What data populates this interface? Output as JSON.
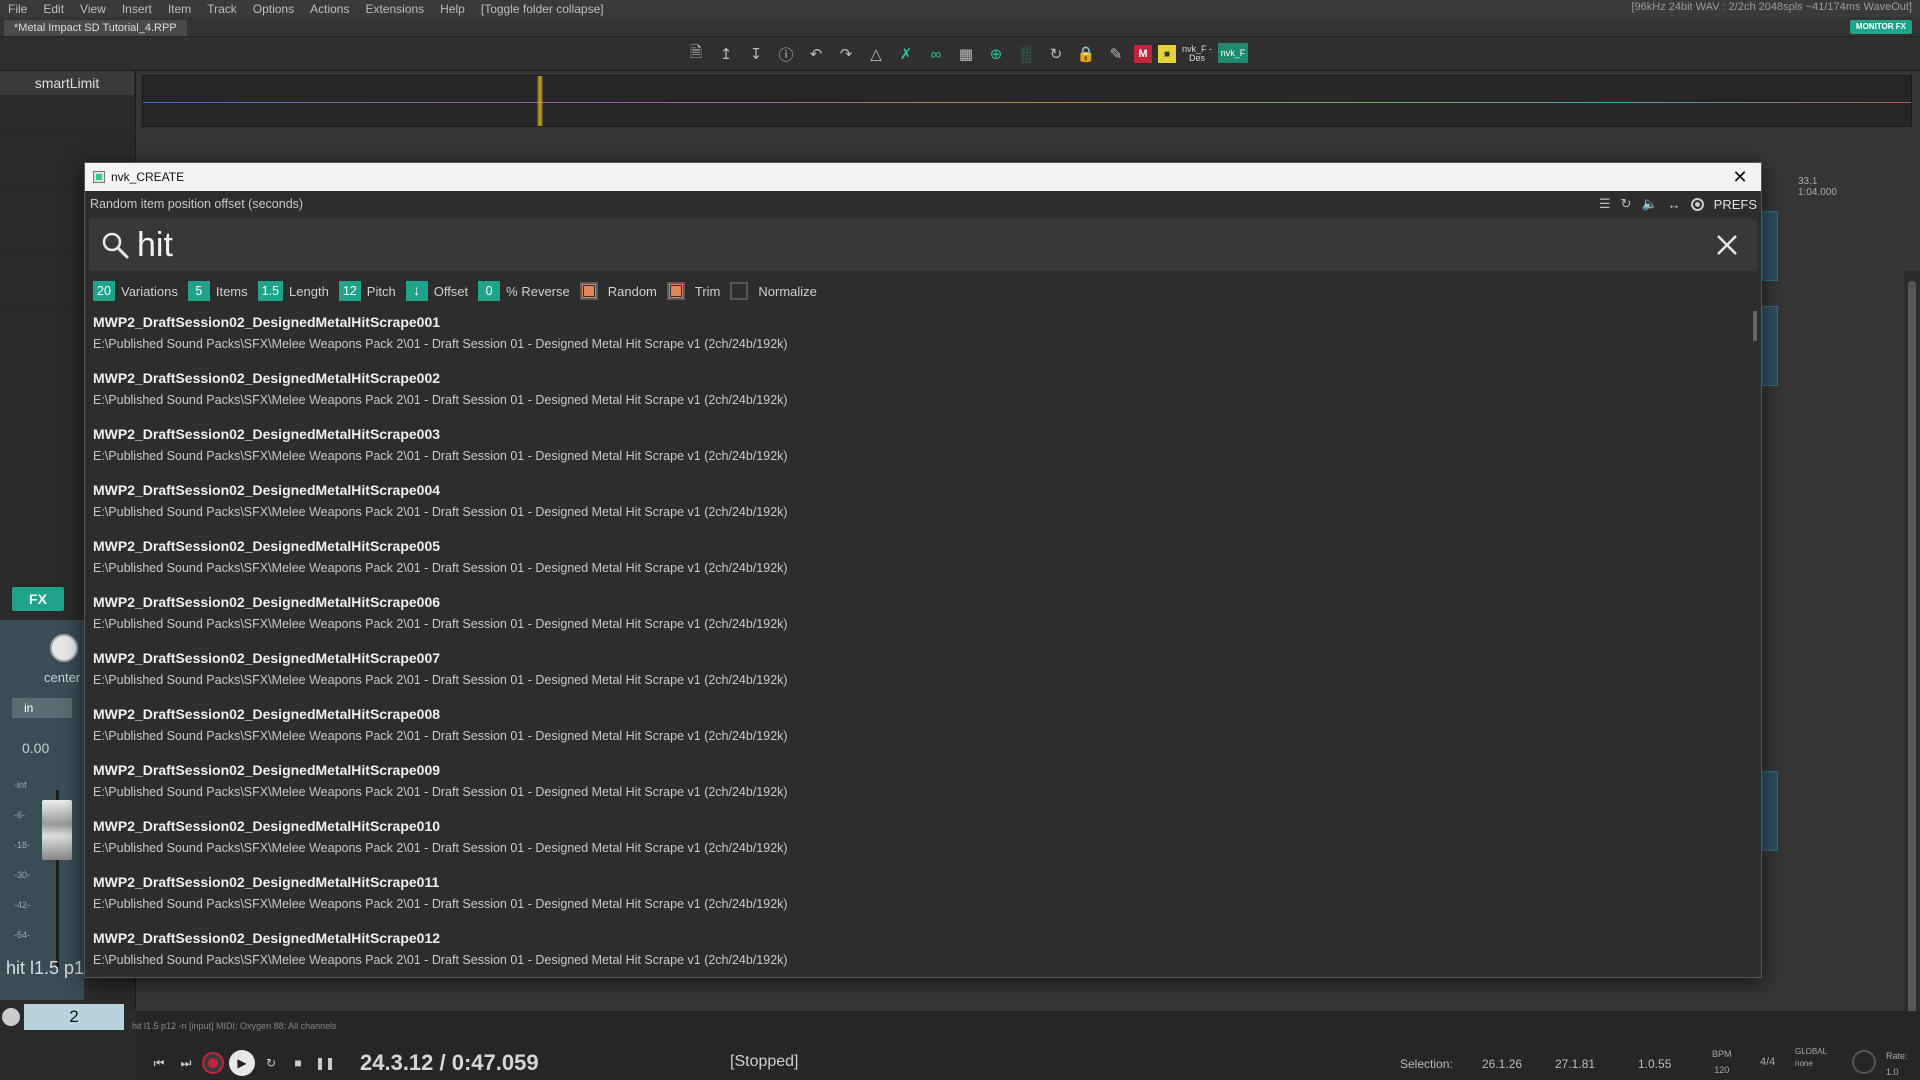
{
  "menu": {
    "items": [
      "File",
      "Edit",
      "View",
      "Insert",
      "Item",
      "Track",
      "Options",
      "Actions",
      "Extensions",
      "Help",
      "[Toggle folder collapse]"
    ],
    "status": "[96kHz 24bit WAV : 2/2ch 2048spls ~41/174ms WaveOut]"
  },
  "project": {
    "tab_label": "*Metal Impact SD Tutorial_4.RPP",
    "monitor_fx": "MONITOR FX"
  },
  "toolbar": {
    "icons": [
      "new-project",
      "save-up",
      "save-down",
      "info",
      "undo",
      "redo",
      "metronome",
      "ripple",
      "link",
      "grid",
      "snap",
      "grid-lines",
      "loop",
      "lock",
      "pencil"
    ],
    "red_label": "M",
    "nvk_des": "nvk_F -Des",
    "nvk_f": "nvk_F"
  },
  "track": {
    "name": "smartLimit",
    "fx_label": "FX",
    "pan_label": "center",
    "in_label": "in",
    "volume": "0.00",
    "db_scale": [
      "-inf",
      "-6-",
      "-18-",
      "-30-",
      "-42-",
      "-54-"
    ],
    "bottom_label": "hit l1.5 p1",
    "number": "2"
  },
  "ruler": {
    "time_top": "33.1",
    "time_bottom": "1:04.000"
  },
  "dialog": {
    "title": "nvk_CREATE",
    "tooltip": "Random item position offset (seconds)",
    "prefs_label": "PREFS",
    "search_value": "hit",
    "params": [
      {
        "value": "20",
        "label": "Variations"
      },
      {
        "value": "5",
        "label": "Items"
      },
      {
        "value": "1.5",
        "label": "Length"
      },
      {
        "value": "12",
        "label": "Pitch"
      },
      {
        "value": "↓",
        "label": "Offset"
      },
      {
        "value": "0",
        "label": "% Reverse"
      }
    ],
    "checks": [
      {
        "label": "Random",
        "checked": true
      },
      {
        "label": "Trim",
        "checked": true
      },
      {
        "label": "Normalize",
        "checked": false
      }
    ],
    "results": [
      {
        "title": "MWP2_DraftSession02_DesignedMetalHitScrape001",
        "path": "E:\\Published Sound Packs\\SFX\\Melee Weapons Pack 2\\01 - Draft Session 01 - Designed Metal Hit Scrape v1 (2ch/24b/192k)"
      },
      {
        "title": "MWP2_DraftSession02_DesignedMetalHitScrape002",
        "path": "E:\\Published Sound Packs\\SFX\\Melee Weapons Pack 2\\01 - Draft Session 01 - Designed Metal Hit Scrape v1 (2ch/24b/192k)"
      },
      {
        "title": "MWP2_DraftSession02_DesignedMetalHitScrape003",
        "path": "E:\\Published Sound Packs\\SFX\\Melee Weapons Pack 2\\01 - Draft Session 01 - Designed Metal Hit Scrape v1 (2ch/24b/192k)"
      },
      {
        "title": "MWP2_DraftSession02_DesignedMetalHitScrape004",
        "path": "E:\\Published Sound Packs\\SFX\\Melee Weapons Pack 2\\01 - Draft Session 01 - Designed Metal Hit Scrape v1 (2ch/24b/192k)"
      },
      {
        "title": "MWP2_DraftSession02_DesignedMetalHitScrape005",
        "path": "E:\\Published Sound Packs\\SFX\\Melee Weapons Pack 2\\01 - Draft Session 01 - Designed Metal Hit Scrape v1 (2ch/24b/192k)"
      },
      {
        "title": "MWP2_DraftSession02_DesignedMetalHitScrape006",
        "path": "E:\\Published Sound Packs\\SFX\\Melee Weapons Pack 2\\01 - Draft Session 01 - Designed Metal Hit Scrape v1 (2ch/24b/192k)"
      },
      {
        "title": "MWP2_DraftSession02_DesignedMetalHitScrape007",
        "path": "E:\\Published Sound Packs\\SFX\\Melee Weapons Pack 2\\01 - Draft Session 01 - Designed Metal Hit Scrape v1 (2ch/24b/192k)"
      },
      {
        "title": "MWP2_DraftSession02_DesignedMetalHitScrape008",
        "path": "E:\\Published Sound Packs\\SFX\\Melee Weapons Pack 2\\01 - Draft Session 01 - Designed Metal Hit Scrape v1 (2ch/24b/192k)"
      },
      {
        "title": "MWP2_DraftSession02_DesignedMetalHitScrape009",
        "path": "E:\\Published Sound Packs\\SFX\\Melee Weapons Pack 2\\01 - Draft Session 01 - Designed Metal Hit Scrape v1 (2ch/24b/192k)"
      },
      {
        "title": "MWP2_DraftSession02_DesignedMetalHitScrape010",
        "path": "E:\\Published Sound Packs\\SFX\\Melee Weapons Pack 2\\01 - Draft Session 01 - Designed Metal Hit Scrape v1 (2ch/24b/192k)"
      },
      {
        "title": "MWP2_DraftSession02_DesignedMetalHitScrape011",
        "path": "E:\\Published Sound Packs\\SFX\\Melee Weapons Pack 2\\01 - Draft Session 01 - Designed Metal Hit Scrape v1 (2ch/24b/192k)"
      },
      {
        "title": "MWP2_DraftSession02_DesignedMetalHitScrape012",
        "path": "E:\\Published Sound Packs\\SFX\\Melee Weapons Pack 2\\01 - Draft Session 01 - Designed Metal Hit Scrape v1 (2ch/24b/192k)"
      }
    ]
  },
  "transport": {
    "midi_status": "hit l1.5 p12 -n [input] MIDI: Oxygen 88: All channels",
    "time": "24.3.12 / 0:47.059",
    "state": "[Stopped]",
    "selection_label": "Selection:",
    "selection_start": "26.1.26",
    "selection_end": "27.1.81",
    "selection_length": "1.0.55",
    "bpm_label": "BPM",
    "bpm_value": "120",
    "time_sig": "4/4",
    "global_label": "GLOBAL",
    "global_value": "none",
    "rate_label": "Rate:",
    "rate_value": "1.0"
  },
  "colors": {
    "accent": "#1fa38a",
    "check": "#e0845b",
    "record": "#c0253a"
  }
}
